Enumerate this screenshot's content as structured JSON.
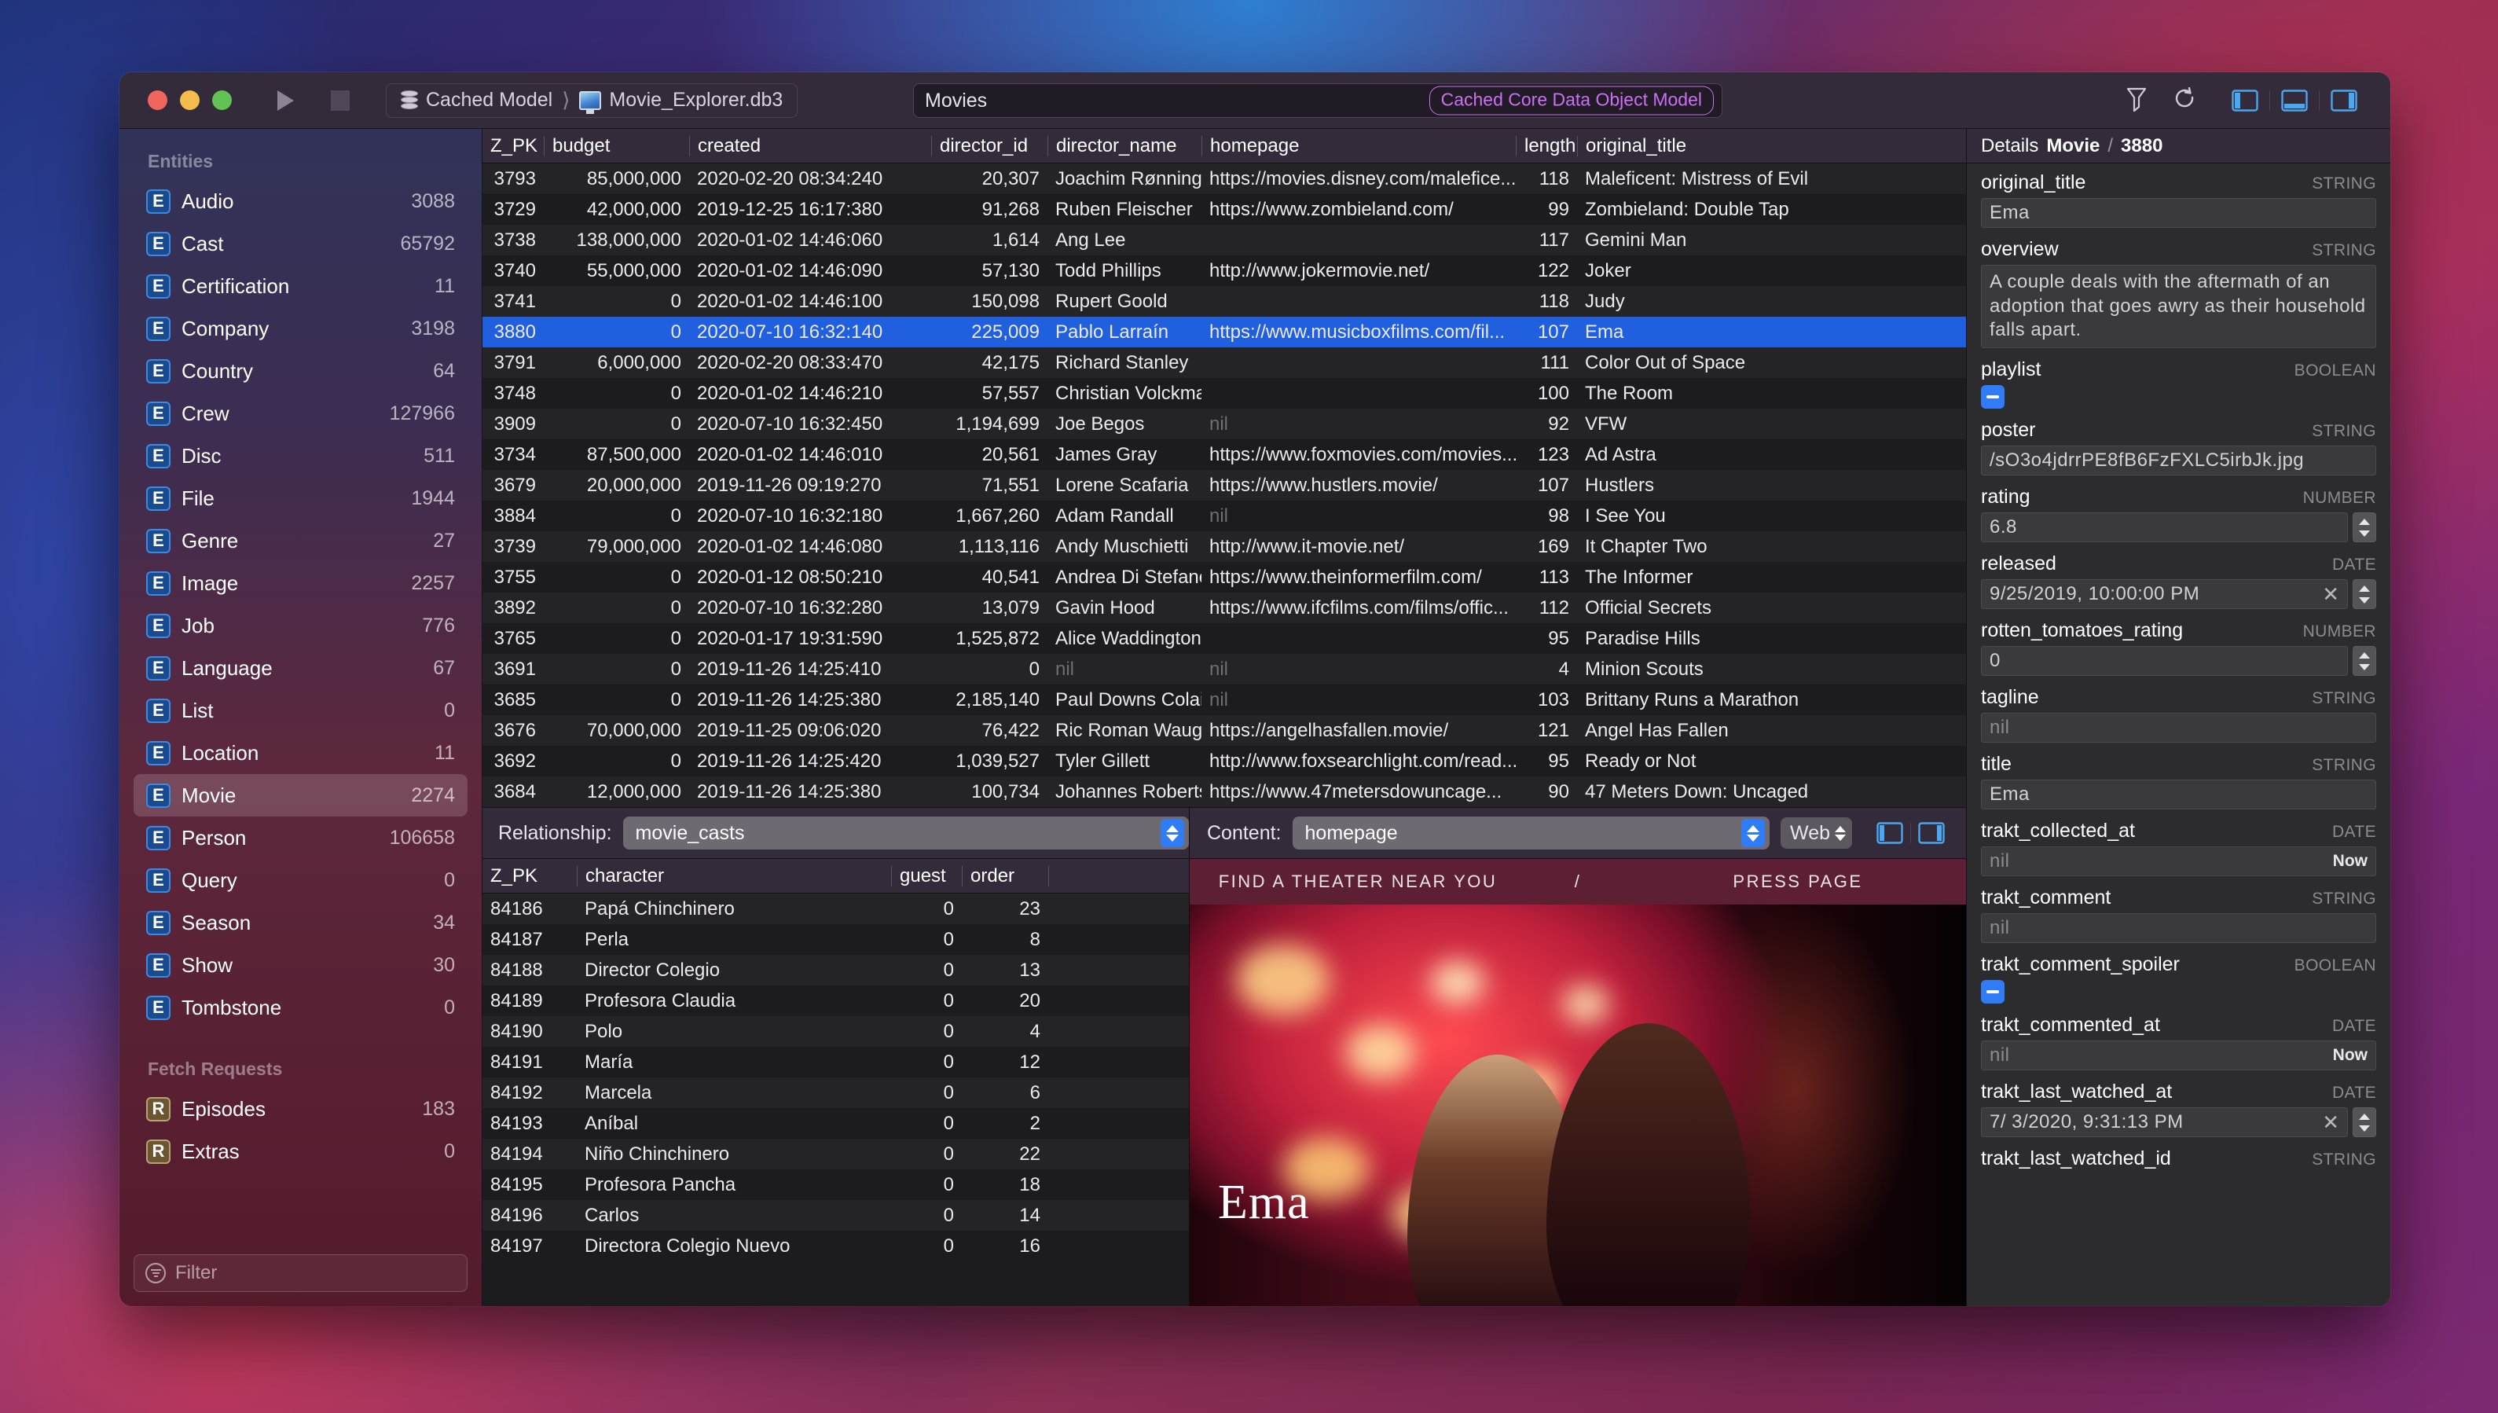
{
  "window": {
    "traffic": [
      "close",
      "minimize",
      "zoom"
    ],
    "play_label": "play",
    "stop_label": "stop",
    "breadcrumb": {
      "model": "Cached Model",
      "file": "Movie_Explorer.db3"
    },
    "search": {
      "value": "Movies",
      "badge": "Cached Core Data Object Model"
    },
    "right_icons": [
      "filter-icon",
      "refresh-icon",
      "left-panel-icon",
      "bottom-panel-icon",
      "right-panel-icon"
    ]
  },
  "sidebar": {
    "entities_header": "Entities",
    "entities": [
      {
        "kind": "E",
        "label": "Audio",
        "count": "3088"
      },
      {
        "kind": "E",
        "label": "Cast",
        "count": "65792"
      },
      {
        "kind": "E",
        "label": "Certification",
        "count": "11"
      },
      {
        "kind": "E",
        "label": "Company",
        "count": "3198"
      },
      {
        "kind": "E",
        "label": "Country",
        "count": "64"
      },
      {
        "kind": "E",
        "label": "Crew",
        "count": "127966"
      },
      {
        "kind": "E",
        "label": "Disc",
        "count": "511"
      },
      {
        "kind": "E",
        "label": "File",
        "count": "1944"
      },
      {
        "kind": "E",
        "label": "Genre",
        "count": "27"
      },
      {
        "kind": "E",
        "label": "Image",
        "count": "2257"
      },
      {
        "kind": "E",
        "label": "Job",
        "count": "776"
      },
      {
        "kind": "E",
        "label": "Language",
        "count": "67"
      },
      {
        "kind": "E",
        "label": "List",
        "count": "0"
      },
      {
        "kind": "E",
        "label": "Location",
        "count": "11"
      },
      {
        "kind": "E",
        "label": "Movie",
        "count": "2274",
        "selected": true
      },
      {
        "kind": "E",
        "label": "Person",
        "count": "106658"
      },
      {
        "kind": "E",
        "label": "Query",
        "count": "0"
      },
      {
        "kind": "E",
        "label": "Season",
        "count": "34"
      },
      {
        "kind": "E",
        "label": "Show",
        "count": "30"
      },
      {
        "kind": "E",
        "label": "Tombstone",
        "count": "0"
      }
    ],
    "fetch_header": "Fetch Requests",
    "fetch_requests": [
      {
        "kind": "R",
        "label": "Episodes",
        "count": "183"
      },
      {
        "kind": "R",
        "label": "Extras",
        "count": "0"
      }
    ],
    "filter_placeholder": "Filter"
  },
  "movies_table": {
    "columns": [
      "Z_PK",
      "budget",
      "created",
      "director_id",
      "director_name",
      "homepage",
      "length",
      "original_title"
    ],
    "rows": [
      {
        "z_pk": "3793",
        "budget": "85,000,000",
        "created": "2020-02-20 08:34:240",
        "director_id": "20,307",
        "director_name": "Joachim Rønning",
        "homepage": "https://movies.disney.com/malefice...",
        "length": "118",
        "original_title": "Maleficent: Mistress of Evil"
      },
      {
        "z_pk": "3729",
        "budget": "42,000,000",
        "created": "2019-12-25 16:17:380",
        "director_id": "91,268",
        "director_name": "Ruben Fleischer",
        "homepage": "https://www.zombieland.com/",
        "length": "99",
        "original_title": "Zombieland: Double Tap"
      },
      {
        "z_pk": "3738",
        "budget": "138,000,000",
        "created": "2020-01-02 14:46:060",
        "director_id": "1,614",
        "director_name": "Ang Lee",
        "homepage": "",
        "length": "117",
        "original_title": "Gemini Man"
      },
      {
        "z_pk": "3740",
        "budget": "55,000,000",
        "created": "2020-01-02 14:46:090",
        "director_id": "57,130",
        "director_name": "Todd Phillips",
        "homepage": "http://www.jokermovie.net/",
        "length": "122",
        "original_title": "Joker"
      },
      {
        "z_pk": "3741",
        "budget": "0",
        "created": "2020-01-02 14:46:100",
        "director_id": "150,098",
        "director_name": "Rupert Goold",
        "homepage": "",
        "length": "118",
        "original_title": "Judy"
      },
      {
        "z_pk": "3880",
        "budget": "0",
        "created": "2020-07-10 16:32:140",
        "director_id": "225,009",
        "director_name": "Pablo Larraín",
        "homepage": "https://www.musicboxfilms.com/fil...",
        "length": "107",
        "original_title": "Ema",
        "selected": true
      },
      {
        "z_pk": "3791",
        "budget": "6,000,000",
        "created": "2020-02-20 08:33:470",
        "director_id": "42,175",
        "director_name": "Richard Stanley",
        "homepage": "",
        "length": "111",
        "original_title": "Color Out of Space"
      },
      {
        "z_pk": "3748",
        "budget": "0",
        "created": "2020-01-02 14:46:210",
        "director_id": "57,557",
        "director_name": "Christian Volckman",
        "homepage": "",
        "length": "100",
        "original_title": "The Room"
      },
      {
        "z_pk": "3909",
        "budget": "0",
        "created": "2020-07-10 16:32:450",
        "director_id": "1,194,699",
        "director_name": "Joe Begos",
        "homepage": "nil",
        "homepage_nil": true,
        "length": "92",
        "original_title": "VFW"
      },
      {
        "z_pk": "3734",
        "budget": "87,500,000",
        "created": "2020-01-02 14:46:010",
        "director_id": "20,561",
        "director_name": "James Gray",
        "homepage": "https://www.foxmovies.com/movies...",
        "length": "123",
        "original_title": "Ad Astra"
      },
      {
        "z_pk": "3679",
        "budget": "20,000,000",
        "created": "2019-11-26 09:19:270",
        "director_id": "71,551",
        "director_name": "Lorene Scafaria",
        "homepage": "https://www.hustlers.movie/",
        "length": "107",
        "original_title": "Hustlers"
      },
      {
        "z_pk": "3884",
        "budget": "0",
        "created": "2020-07-10 16:32:180",
        "director_id": "1,667,260",
        "director_name": "Adam Randall",
        "homepage": "nil",
        "homepage_nil": true,
        "length": "98",
        "original_title": "I See You"
      },
      {
        "z_pk": "3739",
        "budget": "79,000,000",
        "created": "2020-01-02 14:46:080",
        "director_id": "1,113,116",
        "director_name": "Andy Muschietti",
        "homepage": "http://www.it-movie.net/",
        "length": "169",
        "original_title": "It Chapter Two"
      },
      {
        "z_pk": "3755",
        "budget": "0",
        "created": "2020-01-12 08:50:210",
        "director_id": "40,541",
        "director_name": "Andrea Di Stefano",
        "homepage": "https://www.theinformerfilm.com/",
        "length": "113",
        "original_title": "The Informer"
      },
      {
        "z_pk": "3892",
        "budget": "0",
        "created": "2020-07-10 16:32:280",
        "director_id": "13,079",
        "director_name": "Gavin Hood",
        "homepage": "https://www.ifcfilms.com/films/offic...",
        "length": "112",
        "original_title": "Official Secrets"
      },
      {
        "z_pk": "3765",
        "budget": "0",
        "created": "2020-01-17 19:31:590",
        "director_id": "1,525,872",
        "director_name": "Alice Waddington",
        "homepage": "",
        "length": "95",
        "original_title": "Paradise Hills"
      },
      {
        "z_pk": "3691",
        "budget": "0",
        "created": "2019-11-26 14:25:410",
        "director_id": "0",
        "director_name": "nil",
        "director_name_nil": true,
        "homepage": "nil",
        "homepage_nil": true,
        "length": "4",
        "original_title": "Minion Scouts"
      },
      {
        "z_pk": "3685",
        "budget": "0",
        "created": "2019-11-26 14:25:380",
        "director_id": "2,185,140",
        "director_name": "Paul Downs Colaizzo",
        "homepage": "nil",
        "homepage_nil": true,
        "length": "103",
        "original_title": "Brittany Runs a Marathon"
      },
      {
        "z_pk": "3676",
        "budget": "70,000,000",
        "created": "2019-11-25 09:06:020",
        "director_id": "76,422",
        "director_name": "Ric Roman Waugh",
        "homepage": "https://angelhasfallen.movie/",
        "length": "121",
        "original_title": "Angel Has Fallen"
      },
      {
        "z_pk": "3692",
        "budget": "0",
        "created": "2019-11-26 14:25:420",
        "director_id": "1,039,527",
        "director_name": "Tyler Gillett",
        "homepage": "http://www.foxsearchlight.com/read...",
        "length": "95",
        "original_title": "Ready or Not"
      },
      {
        "z_pk": "3684",
        "budget": "12,000,000",
        "created": "2019-11-26 14:25:380",
        "director_id": "100,734",
        "director_name": "Johannes Roberts",
        "homepage": "https://www.47metersdowuncage...",
        "length": "90",
        "original_title": "47 Meters Down: Uncaged"
      }
    ]
  },
  "relbar": {
    "relationship_label": "Relationship:",
    "relationship_value": "movie_casts",
    "content_label": "Content:",
    "content_value": "homepage",
    "mode_value": "Web",
    "view_icons": [
      "split-left-icon",
      "split-right-icon"
    ]
  },
  "casts_table": {
    "columns": [
      "Z_PK",
      "character",
      "guest",
      "order"
    ],
    "rows": [
      {
        "z_pk": "84186",
        "character": "Papá Chinchinero",
        "guest": "0",
        "order": "23"
      },
      {
        "z_pk": "84187",
        "character": "Perla",
        "guest": "0",
        "order": "8"
      },
      {
        "z_pk": "84188",
        "character": "Director Colegio",
        "guest": "0",
        "order": "13"
      },
      {
        "z_pk": "84189",
        "character": "Profesora Claudia",
        "guest": "0",
        "order": "20"
      },
      {
        "z_pk": "84190",
        "character": "Polo",
        "guest": "0",
        "order": "4"
      },
      {
        "z_pk": "84191",
        "character": "María",
        "guest": "0",
        "order": "12"
      },
      {
        "z_pk": "84192",
        "character": "Marcela",
        "guest": "0",
        "order": "6"
      },
      {
        "z_pk": "84193",
        "character": "Aníbal",
        "guest": "0",
        "order": "2"
      },
      {
        "z_pk": "84194",
        "character": "Niño Chinchinero",
        "guest": "0",
        "order": "22"
      },
      {
        "z_pk": "84195",
        "character": "Profesora Pancha",
        "guest": "0",
        "order": "18"
      },
      {
        "z_pk": "84196",
        "character": "Carlos",
        "guest": "0",
        "order": "14"
      },
      {
        "z_pk": "84197",
        "character": "Directora Colegio Nuevo",
        "guest": "0",
        "order": "16"
      }
    ]
  },
  "webview": {
    "nav_left": "FIND A THEATER NEAR YOU",
    "nav_sep": "/",
    "nav_right": "PRESS PAGE",
    "hero_title": "Ema"
  },
  "details": {
    "title_prefix": "Details",
    "entity": "Movie",
    "separator": "/",
    "pk": "3880",
    "fields": [
      {
        "name": "original_title",
        "type": "STRING",
        "value": "Ema",
        "control": "text"
      },
      {
        "name": "overview",
        "type": "STRING",
        "value": "A couple deals with the aftermath of an adoption that goes awry as their household falls apart.",
        "control": "textarea"
      },
      {
        "name": "playlist",
        "type": "BOOLEAN",
        "value": "",
        "control": "checkbox-mixed"
      },
      {
        "name": "poster",
        "type": "STRING",
        "value": "/sO3o4jdrrPE8fB6FzFXLC5irbJk.jpg",
        "control": "text"
      },
      {
        "name": "rating",
        "type": "NUMBER",
        "value": "6.8",
        "control": "stepper"
      },
      {
        "name": "released",
        "type": "DATE",
        "value": "9/25/2019, 10:00:00 PM",
        "control": "date-clear"
      },
      {
        "name": "rotten_tomatoes_rating",
        "type": "NUMBER",
        "value": "0",
        "control": "stepper"
      },
      {
        "name": "tagline",
        "type": "STRING",
        "value": "nil",
        "control": "text-nil"
      },
      {
        "name": "title",
        "type": "STRING",
        "value": "Ema",
        "control": "text"
      },
      {
        "name": "trakt_collected_at",
        "type": "DATE",
        "value": "nil",
        "control": "date-now",
        "action": "Now"
      },
      {
        "name": "trakt_comment",
        "type": "STRING",
        "value": "nil",
        "control": "text-nil"
      },
      {
        "name": "trakt_comment_spoiler",
        "type": "BOOLEAN",
        "value": "",
        "control": "checkbox-mixed"
      },
      {
        "name": "trakt_commented_at",
        "type": "DATE",
        "value": "nil",
        "control": "date-now",
        "action": "Now"
      },
      {
        "name": "trakt_last_watched_at",
        "type": "DATE",
        "value": "7/  3/2020,   9:31:13 PM",
        "control": "date-clear"
      },
      {
        "name": "trakt_last_watched_id",
        "type": "STRING",
        "value": "",
        "control": "label-only"
      }
    ]
  },
  "colors": {
    "selection_blue": "#2060df",
    "accent_purple": "#cd6ff5",
    "control_blue": "#2f7cf6",
    "window_chrome": "#342b3a"
  }
}
